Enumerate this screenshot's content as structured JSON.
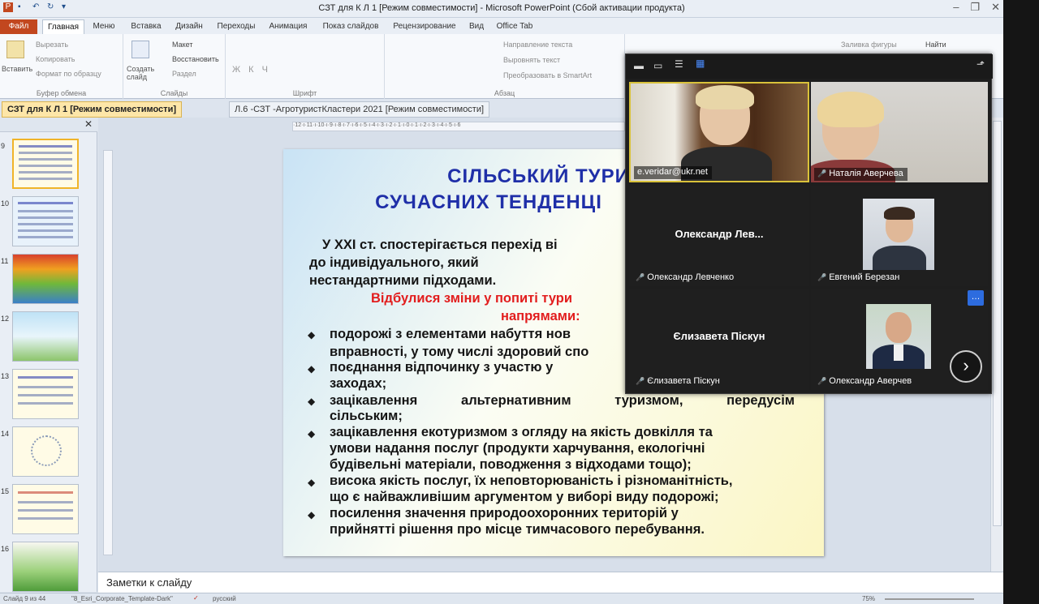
{
  "window": {
    "title": "СЗТ для К Л 1 [Режим совместимости] - Microsoft PowerPoint (Сбой активации продукта)"
  },
  "ribbon_tabs": [
    "Файл",
    "Главная",
    "Меню",
    "Вставка",
    "Дизайн",
    "Переходы",
    "Анимация",
    "Показ слайдов",
    "Рецензирование",
    "Вид",
    "Office Tab"
  ],
  "ribbon": {
    "paste_label": "Вставить",
    "cut": "Вырезать",
    "copy": "Копировать",
    "format_painter": "Формат по образцу",
    "clipboard_group": "Буфер обмена",
    "new_slide_label": "Создать слайд",
    "layout": "Макет",
    "reset": "Восстановить",
    "section": "Раздел",
    "slides_group": "Слайды",
    "font_group": "Шрифт",
    "text_direction": "Направление текста",
    "align_text": "Выровнять текст",
    "smartart": "Преобразовать в SmartArt",
    "paragraph_group": "Абзац",
    "shape_fill": "Заливка фигуры",
    "find": "Найти"
  },
  "doc_tabs": [
    "СЗТ для К Л 1 [Режим совместимости]",
    "Л.6 -СЗТ -АгротуристКластери  2021 [Режим совместимости]"
  ],
  "thumbnails": [
    {
      "num": "9"
    },
    {
      "num": "10"
    },
    {
      "num": "11"
    },
    {
      "num": "12"
    },
    {
      "num": "13"
    },
    {
      "num": "14"
    },
    {
      "num": "15"
    },
    {
      "num": "16"
    }
  ],
  "slide": {
    "title_line1": "СІЛЬСЬКИЙ ТУРИЗМ",
    "title_line2": "СУЧАСНИХ ТЕНДЕНЦІ",
    "intro_line1": "У XXI ст. спостерігається перехід ві",
    "intro_line2": "до        індивідуального,        який",
    "intro_line3": "нестандартними підходами.",
    "red_line1": "Відбулися зміни у попиті тури",
    "red_line2": "напрямами:",
    "bullets": [
      {
        "l1": "подорожі з елементами набуття нов",
        "l2": "вправності, у тому числі здоровий спо"
      },
      {
        "l1": "поєднання відпочинку з участю у",
        "l2": "заходах;"
      },
      {
        "l1": "зацікавлення    альтернативним    туризмом,    передусім",
        "l2": "сільським;"
      },
      {
        "l1": "зацікавлення екотуризмом з огляду на якість довкілля та",
        "l2": "умови надання послуг (продукти харчування, екологічні",
        "l3": "будівельні матеріали, поводження з відходами тощо);"
      },
      {
        "l1": "висока якість послуг, їх неповторюваність і різноманітність,",
        "l2": "що є найважливішим аргументом у виборі виду подорожі;"
      },
      {
        "l1": "посилення    значення    природоохоронних    територій    у",
        "l2": "прийнятті рішення про місце тимчасового перебування."
      }
    ]
  },
  "notes_placeholder": "Заметки к слайду",
  "status": {
    "slide_info": "Слайд 9 из 44",
    "theme": "\"8_Esri_Corporate_Template-Dark\"",
    "language": "русский",
    "zoom": "75%"
  },
  "video_call": {
    "participants": [
      {
        "name": "e.veridar@ukr.net",
        "muted": false,
        "video": true,
        "active": true
      },
      {
        "name": "Наталія Аверчева",
        "muted": true,
        "video": true
      },
      {
        "name": "Олександр Левченко",
        "display": "Олександр  Лев...",
        "muted": true,
        "video": false
      },
      {
        "name": "Евгений Березан",
        "muted": true,
        "video": true
      },
      {
        "name": "Єлизавета Піскун",
        "display": "Єлизавета Піскун",
        "muted": true,
        "video": false
      },
      {
        "name": "Олександр Аверчев",
        "muted": true,
        "video": true
      }
    ]
  }
}
